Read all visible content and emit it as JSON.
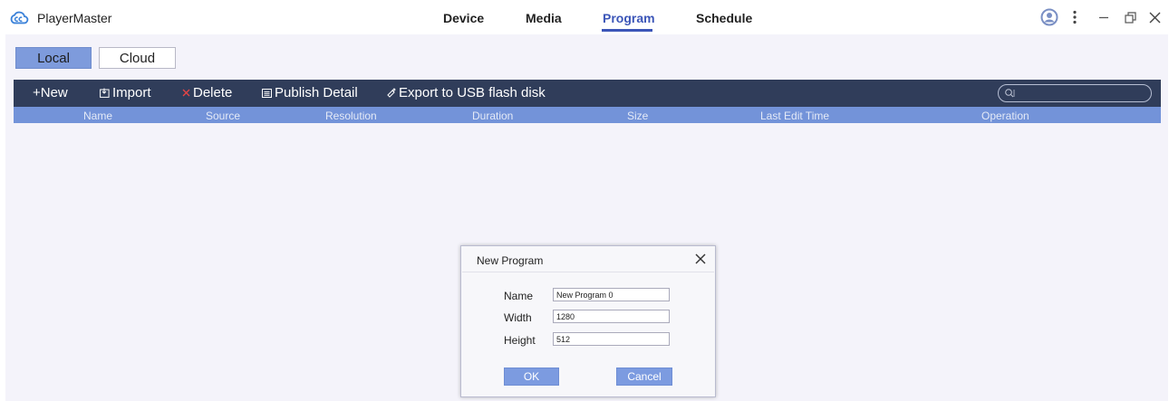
{
  "app": {
    "name": "PlayerMaster",
    "logo_icon": "cloud-logo-icon"
  },
  "nav": {
    "tabs": [
      {
        "label": "Device"
      },
      {
        "label": "Media"
      },
      {
        "label": "Program",
        "active": true
      },
      {
        "label": "Schedule"
      }
    ]
  },
  "window_controls": [
    "user-icon",
    "more-icon",
    "minimize-icon",
    "restore-icon",
    "close-icon"
  ],
  "source_tabs": {
    "local": "Local",
    "cloud": "Cloud",
    "active": "Local"
  },
  "toolbar": {
    "new_label": "+New",
    "import_label": "Import",
    "delete_label": "Delete",
    "publish_label": "Publish Detail",
    "export_label": "Export to USB flash disk",
    "search_placeholder": ""
  },
  "table": {
    "columns": [
      "Name",
      "Source",
      "Resolution",
      "Duration",
      "Size",
      "Last Edit Time",
      "Operation"
    ],
    "rows": []
  },
  "dialog": {
    "title": "New Program",
    "fields": {
      "name": {
        "label": "Name",
        "value": "New Program 0"
      },
      "width": {
        "label": "Width",
        "value": "1280"
      },
      "height": {
        "label": "Height",
        "value": "512"
      }
    },
    "ok_label": "OK",
    "cancel_label": "Cancel"
  },
  "colors": {
    "accent": "#3c56b8",
    "toolbar_bg": "#303d5a",
    "header_bg": "#7393d9",
    "button_bg": "#7c9be0",
    "delete_x": "#e84545",
    "main_bg": "#f4f3fa"
  }
}
